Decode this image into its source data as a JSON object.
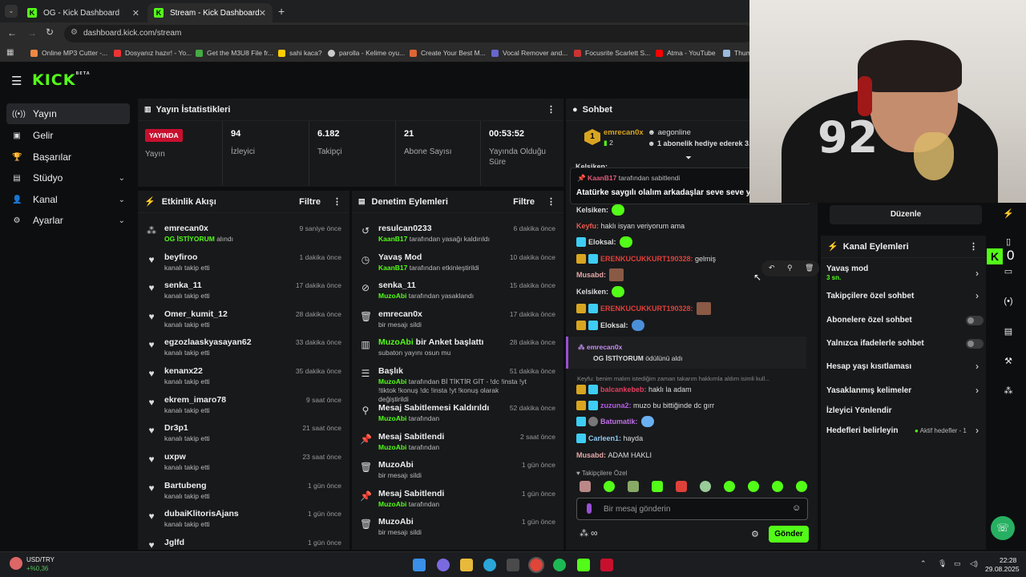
{
  "browser": {
    "tabs": [
      {
        "label": "OG - Kick Dashboard"
      },
      {
        "label": "Stream - Kick Dashboard"
      }
    ],
    "new_tab": "+",
    "url": "dashboard.kick.com/stream",
    "bookmarks": [
      {
        "label": "Online MP3 Cutter -..."
      },
      {
        "label": "Dosyanız hazır! - Yo..."
      },
      {
        "label": "Get the M3U8 File fr..."
      },
      {
        "label": "sahi kaca?"
      },
      {
        "label": "parolla - Kelime oyu..."
      },
      {
        "label": "Create Your Best M..."
      },
      {
        "label": "Vocal Remover and..."
      },
      {
        "label": "Focusrite Scarlett S..."
      },
      {
        "label": "Atma - YouTube"
      },
      {
        "label": "Thum"
      }
    ]
  },
  "logo": {
    "text": "KICK",
    "beta": "BETA"
  },
  "sidebar": {
    "items": [
      {
        "label": "Yayın"
      },
      {
        "label": "Gelir"
      },
      {
        "label": "Başarılar"
      },
      {
        "label": "Stüdyo"
      },
      {
        "label": "Kanal"
      },
      {
        "label": "Ayarlar"
      }
    ]
  },
  "stats": {
    "title": "Yayın İstatistikleri",
    "live_badge": "YAYINDA",
    "live_label": "Yayın",
    "items": [
      {
        "value": "94",
        "label": "İzleyici"
      },
      {
        "value": "6.182",
        "label": "Takipçi"
      },
      {
        "value": "21",
        "label": "Abone Sayısı"
      },
      {
        "value": "00:53:52",
        "label": "Yayında Olduğu Süre"
      }
    ]
  },
  "activity": {
    "title": "Etkinlik Akışı",
    "filter": "Filtre",
    "rows": [
      {
        "name": "emrecan0x",
        "sub_hl": "OG İSTİYORUM",
        "sub": "alındı",
        "time": "9 saniye önce"
      },
      {
        "name": "beyfiroo",
        "sub": "kanalı takip etti",
        "time": "1 dakika önce"
      },
      {
        "name": "senka_11",
        "sub": "kanalı takip etti",
        "time": "17 dakika önce"
      },
      {
        "name": "Omer_kumit_12",
        "sub": "kanalı takip etti",
        "time": "28 dakika önce"
      },
      {
        "name": "egzozlaaskyasayan62",
        "sub": "kanalı takip etti",
        "time": "33 dakika önce"
      },
      {
        "name": "kenanx22",
        "sub": "kanalı takip etti",
        "time": "35 dakika önce"
      },
      {
        "name": "ekrem_imaro78",
        "sub": "kanalı takip etti",
        "time": "9 saat önce"
      },
      {
        "name": "Dr3p1",
        "sub": "kanalı takip etti",
        "time": "21 saat önce"
      },
      {
        "name": "uxpw",
        "sub": "kanalı takip etti",
        "time": "23 saat önce"
      },
      {
        "name": "Bartubeng",
        "sub": "kanalı takip etti",
        "time": "1 gün önce"
      },
      {
        "name": "dubaiKlitorisAjans",
        "sub": "kanalı takip etti",
        "time": "1 gün önce"
      },
      {
        "name": "Jglfd",
        "sub": "",
        "time": "1 gün önce"
      }
    ]
  },
  "moderation": {
    "title": "Denetim Eylemleri",
    "filter": "Filtre",
    "rows": [
      {
        "name": "resulcan0233",
        "mod": "KaanB17",
        "sub": "tarafından yasağı kaldırıldı",
        "time": "6 dakika önce"
      },
      {
        "name": "Yavaş Mod",
        "mod": "KaanB17",
        "sub": "tarafından etkinleştirildi",
        "time": "10 dakika önce"
      },
      {
        "name": "senka_11",
        "mod": "MuzoAbi",
        "sub": "tarafından yasaklandı",
        "time": "15 dakika önce"
      },
      {
        "name": "emrecan0x",
        "mod": "",
        "sub": "bir mesajı sildi",
        "time": "17 dakika önce"
      },
      {
        "name_hl": "MuzoAbi",
        "name": "bir Anket başlattı",
        "mod": "",
        "sub": "subaton yayını osun mu",
        "time": "28 dakika önce"
      },
      {
        "name": "Başlık",
        "mod": "MuzoAbi",
        "sub": "tarafından Bİ TİKTİR GİT - !dc !insta !yt !tiktok !konuş !dc !insta !yt !konuş olarak değiştirildi",
        "time": "51 dakika önce"
      },
      {
        "name": "Mesaj Sabitlemesi Kaldırıldı",
        "mod": "MuzoAbi",
        "sub": "tarafından",
        "time": "52 dakika önce"
      },
      {
        "name": "Mesaj Sabitlendi",
        "mod": "MuzoAbi",
        "sub": "tarafından",
        "time": "2 saat önce"
      },
      {
        "name": "MuzoAbi",
        "mod": "",
        "sub": "bir mesajı sildi",
        "time": "1 gün önce"
      },
      {
        "name": "Mesaj Sabitlendi",
        "mod": "MuzoAbi",
        "sub": "tarafından",
        "time": "1 gün önce"
      },
      {
        "name": "MuzoAbi",
        "mod": "",
        "sub": "bir mesajı sildi",
        "time": "1 gün önce"
      }
    ]
  },
  "chat": {
    "title": "Sohbet",
    "top_gifter": {
      "name": "emrecan0x",
      "count": "2",
      "rank": "1"
    },
    "online_user": "aegonline",
    "gift_text": "1 abonelik hediye ederek 3.",
    "pinned": {
      "by": "KaanB17",
      "by_suffix": "tarafından sabitlendi",
      "text": "Atatürke saygılı olalım arkadaşlar seve seve ya d"
    },
    "messages": [
      {
        "user": "Kelsiken:",
        "text": ""
      },
      {
        "user": "Keyfu:",
        "text": "haklı isyan veriyorum ama"
      },
      {
        "user": "Eloksal:",
        "text": ""
      },
      {
        "user": "ERENKUCUKKURT190328:",
        "text": "gelmiş"
      },
      {
        "user": "Musabd:",
        "text": ""
      },
      {
        "user": "Kelsiken:",
        "text": ""
      },
      {
        "user": "ERENKUCUKKURT190328:",
        "text": ""
      },
      {
        "user": "Eloksal:",
        "text": ""
      }
    ],
    "redeem": {
      "user": "emrecan0x",
      "reward": "OG İSTİYORUM",
      "suffix": "ödülünü aldı"
    },
    "reply_preview": "Keyfu: benim malım istediğim zaman takarım hakkımla aldım isimli kull...",
    "messages2": [
      {
        "user": "balcankebeb:",
        "text": "haklı la adam"
      },
      {
        "user": "zuzuna2:",
        "text": "muzo bu bittiğinde dc gırr"
      },
      {
        "user": "Batumatik:",
        "text": ""
      },
      {
        "user": "Carleen1:",
        "text": "hayda"
      },
      {
        "user": "Musabd:",
        "text": "ADAM HAKLI"
      }
    ],
    "followers_only": "Takipçilere Özel",
    "input_placeholder": "Bir mesaj gönderin",
    "send_button": "Gönder",
    "infinity": "∞"
  },
  "channel_actions": {
    "edit_button": "Düzenle",
    "title": "Kanal Eylemleri",
    "items": [
      {
        "label": "Yavaş mod",
        "sub": "3 sn."
      },
      {
        "label": "Takipçilere özel sohbet"
      },
      {
        "label": "Abonelere özel sohbet"
      },
      {
        "label": "Yalnızca ifadelerle sohbet"
      },
      {
        "label": "Hesap yaşı kısıtlaması"
      },
      {
        "label": "Yasaklanmış kelimeler"
      },
      {
        "label": "İzleyici Yönlendir"
      },
      {
        "label": "Hedefleri belirleyin",
        "sub": "Aktif hedefler - 1"
      }
    ]
  },
  "overlay_count": "0",
  "taskbar": {
    "ticker": "USD/TRY",
    "ticker_change": "+%0,36",
    "time": "22:28",
    "date": "29.08.2025"
  },
  "colors": {
    "accent": "#53fc18",
    "bg": "#0d0e10",
    "panel": "#18191b",
    "live": "#c8102e"
  }
}
